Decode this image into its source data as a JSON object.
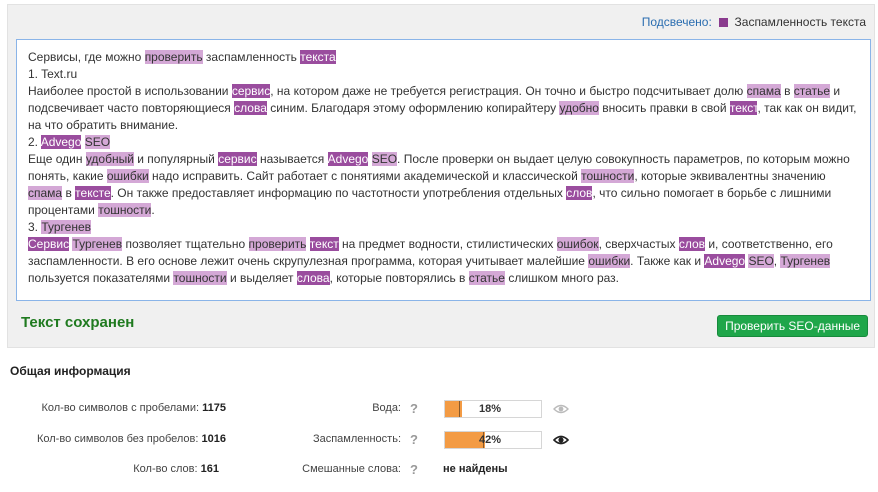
{
  "legend": {
    "prefix": "Подсвечено:",
    "label": "Заспамленность текста"
  },
  "editor_colors": {
    "highlight_light": "#d4a8d6",
    "highlight_dark": "#9a4d9e"
  },
  "editor": {
    "paragraphs": [
      [
        {
          "t": "Сервисы, где можно "
        },
        {
          "t": "проверить",
          "h": "l"
        },
        {
          "t": " заспамленность "
        },
        {
          "t": "текста",
          "h": "d"
        }
      ],
      [
        {
          "t": "1. Text.ru"
        }
      ],
      [
        {
          "t": "Наиболее простой в использовании "
        },
        {
          "t": "сервис",
          "h": "d"
        },
        {
          "t": ", на котором даже не требуется регистрация. Он точно и быстро подсчитывает долю "
        },
        {
          "t": "спама",
          "h": "l"
        },
        {
          "t": " в "
        },
        {
          "t": "статье",
          "h": "l"
        },
        {
          "t": " и подсвечивает часто повторяющиеся "
        },
        {
          "t": "слова",
          "h": "d"
        },
        {
          "t": " синим. Благодаря этому оформлению копирайтеру "
        },
        {
          "t": "удобно",
          "h": "l"
        },
        {
          "t": " вносить правки в свой "
        },
        {
          "t": "текст",
          "h": "d"
        },
        {
          "t": ", так как он видит, на что обратить внимание."
        }
      ],
      [
        {
          "t": "2. "
        },
        {
          "t": "Advego",
          "h": "d"
        },
        {
          "t": " "
        },
        {
          "t": "SEO",
          "h": "l"
        }
      ],
      [
        {
          "t": "Еще один "
        },
        {
          "t": "удобный",
          "h": "l"
        },
        {
          "t": " и популярный "
        },
        {
          "t": "сервис",
          "h": "d"
        },
        {
          "t": " называется "
        },
        {
          "t": "Advego",
          "h": "d"
        },
        {
          "t": " "
        },
        {
          "t": "SEO",
          "h": "l"
        },
        {
          "t": ". После проверки он выдает целую совокупность параметров, по которым можно понять, какие "
        },
        {
          "t": "ошибки",
          "h": "l"
        },
        {
          "t": " надо исправить. Сайт работает с понятиями академической и классической "
        },
        {
          "t": "тошности",
          "h": "l"
        },
        {
          "t": ", которые эквивалентны значению "
        },
        {
          "t": "спама",
          "h": "l"
        },
        {
          "t": " в "
        },
        {
          "t": "тексте",
          "h": "d"
        },
        {
          "t": ". Он также предоставляет информацию по частотности употребления отдельных "
        },
        {
          "t": "слов",
          "h": "d"
        },
        {
          "t": ", что сильно помогает в борьбе с лишними процентами "
        },
        {
          "t": "тошности",
          "h": "l"
        },
        {
          "t": "."
        }
      ],
      [
        {
          "t": "3. "
        },
        {
          "t": "Тургенев",
          "h": "l"
        }
      ],
      [
        {
          "t": "Сервис",
          "h": "d"
        },
        {
          "t": " "
        },
        {
          "t": "Тургенев",
          "h": "l"
        },
        {
          "t": " позволяет тщательно "
        },
        {
          "t": "проверить",
          "h": "l"
        },
        {
          "t": " "
        },
        {
          "t": "текст",
          "h": "d"
        },
        {
          "t": " на предмет водности, стилистических "
        },
        {
          "t": "ошибок",
          "h": "l"
        },
        {
          "t": ", сверхчастых "
        },
        {
          "t": "слов",
          "h": "d"
        },
        {
          "t": " и, соответственно, его заспамленности. В его основе лежит очень скрупулезная программа, которая учитывает малейшие "
        },
        {
          "t": "ошибки",
          "h": "l"
        },
        {
          "t": ". Также как и "
        },
        {
          "t": "Advego",
          "h": "d"
        },
        {
          "t": " "
        },
        {
          "t": "SEO",
          "h": "l"
        },
        {
          "t": ", "
        },
        {
          "t": "Тургенев",
          "h": "l"
        },
        {
          "t": " пользуется показателями "
        },
        {
          "t": "тошности",
          "h": "l"
        },
        {
          "t": " и выделяет "
        },
        {
          "t": "слова",
          "h": "d"
        },
        {
          "t": ", которые повторялись в "
        },
        {
          "t": "статье",
          "h": "l"
        },
        {
          "t": " слишком много раз."
        }
      ]
    ]
  },
  "status": {
    "saved": "Текст сохранен"
  },
  "actions": {
    "check_seo": "Проверить SEO-данные"
  },
  "info": {
    "title": "Общая информация",
    "chars_with_spaces_label": "Кол-во символов с пробелами:",
    "chars_with_spaces": "1175",
    "chars_without_spaces_label": "Кол-во символов без пробелов:",
    "chars_without_spaces": "1016",
    "words_label": "Кол-во слов:",
    "words": "161",
    "help": "?",
    "water_label": "Вода:",
    "water_value": "18%",
    "water_fraction": 0.18,
    "water_marker_fraction": 0.15,
    "spam_label": "Заспамленность:",
    "spam_value": "42%",
    "spam_fraction": 0.42,
    "spam_marker_fraction": 0.4,
    "mixed_label": "Смешанные слова:",
    "mixed_value": "не найдены"
  },
  "icons": {
    "legend_swatch": "#8a3b8e",
    "water_eye": "eye-icon-disabled",
    "spam_eye": "eye-icon"
  }
}
